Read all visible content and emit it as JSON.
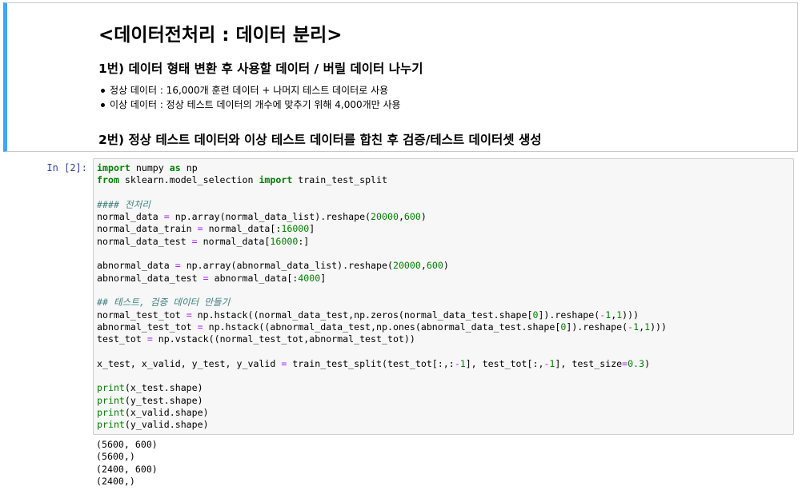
{
  "markdown_cell": {
    "heading": "<데이터전처리 : 데이터 분리>",
    "step1": "1번) 데이터 형태 변환 후 사용할 데이터 / 버릴 데이터 나누기",
    "bullets": [
      "정상 데이터 : 16,000개 훈련 데이터 + 나머지 테스트 데이터로 사용",
      "이상 데이터 : 정상 테스트 데이터의 개수에 맞추기 위해 4,000개만 사용"
    ],
    "step2": "2번) 정상 테스트 데이터와 이상 테스트 데이터를 합친 후 검증/테스트 데이터셋 생성"
  },
  "code_cell": {
    "prompt": "In [2]:",
    "lines": [
      "import numpy as np",
      "from sklearn.model_selection import train_test_split",
      "",
      "#### 전처리",
      "normal_data = np.array(normal_data_list).reshape(20000,600)",
      "normal_data_train = normal_data[:16000]",
      "normal_data_test = normal_data[16000:]",
      "",
      "abnormal_data = np.array(abnormal_data_list).reshape(20000,600)",
      "abnormal_data_test = abnormal_data[:4000]",
      "",
      "## 테스트, 검증 데이터 만들기",
      "normal_test_tot = np.hstack((normal_data_test,np.zeros(normal_data_test.shape[0]).reshape(-1,1)))",
      "abnormal_test_tot = np.hstack((abnormal_data_test,np.ones(abnormal_data_test.shape[0]).reshape(-1,1)))",
      "test_tot = np.vstack((normal_test_tot,abnormal_test_tot))",
      "",
      "x_test, x_valid, y_test, y_valid = train_test_split(test_tot[:,:-1], test_tot[:,-1], test_size=0.3)",
      "",
      "print(x_test.shape)",
      "print(y_test.shape)",
      "print(x_valid.shape)",
      "print(y_valid.shape)"
    ],
    "output": [
      "(5600, 600)",
      "(5600,)",
      "(2400, 600)",
      "(2400,)"
    ]
  },
  "colors": {
    "selected_cell_bar": "#42a5f5",
    "prompt": "#303f9f",
    "keyword": "#008000",
    "operator": "#aa22ff",
    "comment": "#408080"
  }
}
